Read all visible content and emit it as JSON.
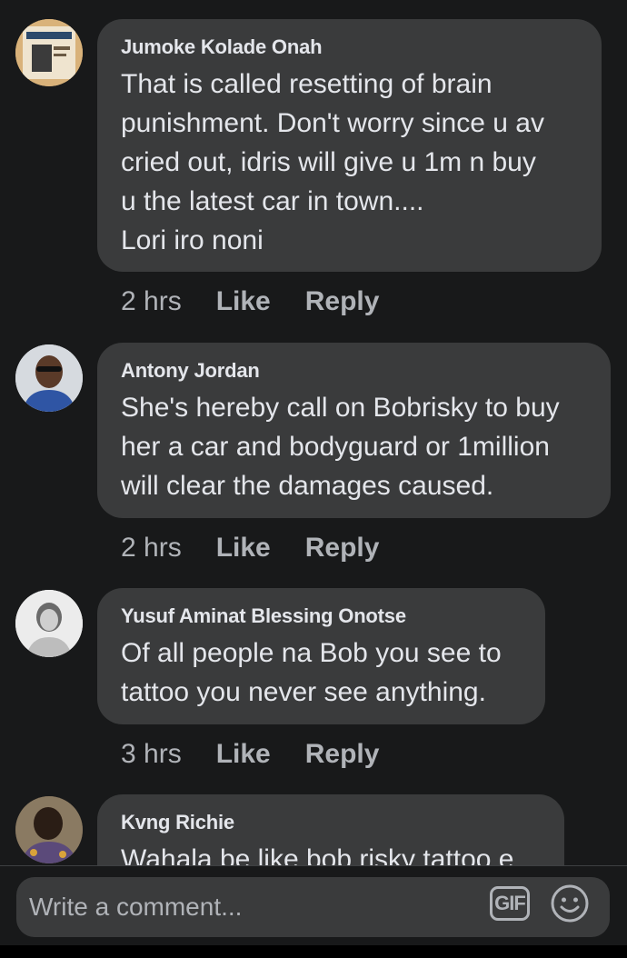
{
  "comments": [
    {
      "author": "Jumoke Kolade Onah",
      "lines": [
        "That is called resetting of brain",
        "punishment. Don't worry since u av",
        "cried out, idris will give u 1m n buy",
        "u the latest car in town....",
        "Lori iro noni"
      ],
      "time": "2 hrs",
      "like": "Like",
      "reply": "Reply"
    },
    {
      "author": "Antony Jordan",
      "lines": [
        "She's hereby call on Bobrisky to buy",
        "her a car and bodyguard or 1million",
        "will clear the damages caused."
      ],
      "time": "2 hrs",
      "like": "Like",
      "reply": "Reply"
    },
    {
      "author": "Yusuf Aminat Blessing Onotse",
      "lines": [
        "Of all people na Bob you see to",
        "tattoo you never see anything."
      ],
      "time": "3 hrs",
      "like": "Like",
      "reply": "Reply"
    },
    {
      "author": "Kvng Richie",
      "lines": [
        "Wahala be like bob risky tattoo e"
      ]
    }
  ],
  "composer": {
    "placeholder": "Write a comment...",
    "gif_label": "GIF"
  },
  "icons": {
    "emoji": "emoji-icon",
    "gif": "gif-icon"
  },
  "colors": {
    "background": "#18191a",
    "bubble": "#3a3b3c",
    "text": "#e4e6eb",
    "secondary": "#b0b3b8"
  }
}
